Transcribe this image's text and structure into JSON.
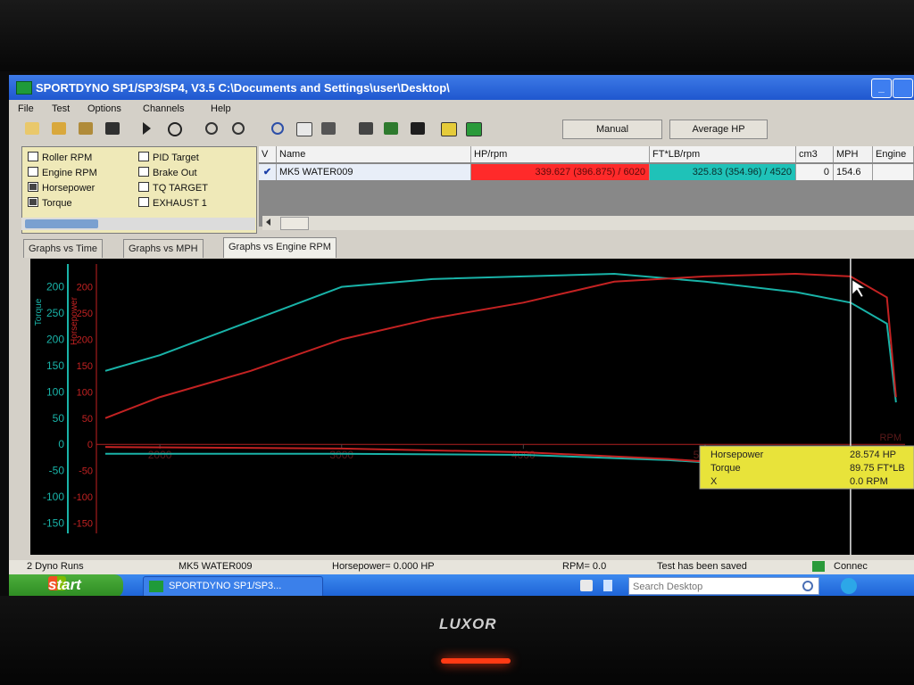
{
  "window": {
    "title": "SPORTDYNO SP1/SP3/SP4, V3.5  C:\\Documents and Settings\\user\\Desktop\\",
    "minimize_glyph": "_"
  },
  "menu": [
    "File",
    "Test",
    "Options",
    "Channels",
    "Help"
  ],
  "toolbar": {
    "manual_label": "Manual",
    "average_hp_label": "Average HP"
  },
  "channels": [
    {
      "label": "Roller RPM",
      "checked": false
    },
    {
      "label": "Engine RPM",
      "checked": false
    },
    {
      "label": "Horsepower",
      "checked": true
    },
    {
      "label": "Torque",
      "checked": true
    },
    {
      "label": "PID Target",
      "checked": false
    },
    {
      "label": "Brake Out",
      "checked": false
    },
    {
      "label": "TQ TARGET",
      "checked": false
    },
    {
      "label": "EXHAUST 1",
      "checked": false
    }
  ],
  "runs_table": {
    "headers": [
      "V",
      "Name",
      "HP/rpm",
      "FT*LB/rpm",
      "cm3",
      "MPH",
      "Engine"
    ],
    "row": {
      "name": "MK5 WATER009",
      "hp_rpm": "339.627 (396.875) / 6020",
      "ftlb_rpm": "325.83 (354.96) / 4520",
      "cm3": "0",
      "mph": "154.6"
    }
  },
  "tabs": [
    "Graphs vs Time",
    "Graphs vs MPH",
    "Graphs vs Engine RPM"
  ],
  "active_tab": 2,
  "chart_data": {
    "type": "line",
    "xlabel": "RPM",
    "ylabel_left": "Torque",
    "ylabel_right": "Horsepower",
    "x_ticks": [
      "2000",
      "3000",
      "4000",
      "5000"
    ],
    "y_ticks_left": [
      "200",
      "250",
      "200",
      "150",
      "100",
      "50",
      "0",
      "-50",
      "-100",
      "-150"
    ],
    "y_ticks_right": [
      "200",
      "250",
      "200",
      "150",
      "100",
      "50",
      "0",
      "-50",
      "-100",
      "-150"
    ],
    "xlim": [
      1700,
      6100
    ],
    "ylim": [
      -190,
      330
    ],
    "series": [
      {
        "name": "Torque",
        "color": "#19b3a8",
        "x": [
          1700,
          2000,
          2500,
          3000,
          3500,
          4000,
          4500,
          5000,
          5500,
          5800,
          6000,
          6050
        ],
        "values": [
          140,
          170,
          235,
          300,
          315,
          320,
          325,
          310,
          290,
          270,
          230,
          80
        ]
      },
      {
        "name": "Horsepower",
        "color": "#c32222",
        "x": [
          1700,
          2000,
          2500,
          3000,
          3500,
          4000,
          4500,
          5000,
          5500,
          5800,
          6000,
          6050
        ],
        "values": [
          50,
          90,
          140,
          200,
          240,
          270,
          310,
          320,
          325,
          320,
          280,
          90
        ]
      },
      {
        "name": "Torque trace",
        "color": "#19b3a8",
        "x": [
          1700,
          3000,
          4000,
          4800,
          5500
        ],
        "values": [
          -18,
          -18,
          -20,
          -30,
          -45
        ]
      },
      {
        "name": "Horsepower trace",
        "color": "#c32222",
        "x": [
          1700,
          3000,
          4000,
          4800,
          5500
        ],
        "values": [
          -5,
          -8,
          -15,
          -28,
          -45
        ]
      }
    ],
    "cursor_x": 5800
  },
  "cursor_readout": [
    {
      "label": "Horsepower",
      "value": "28.574 HP"
    },
    {
      "label": "Torque",
      "value": "89.75 FT*LB"
    },
    {
      "label": "X",
      "value": "0.0 RPM"
    }
  ],
  "status": {
    "runs": "2 Dyno Runs",
    "run_name": "MK5 WATER009",
    "hp": "Horsepower= 0.000 HP",
    "rpm": "RPM= 0.0",
    "message": "Test has been saved",
    "connection": "Connec"
  },
  "taskbar": {
    "start_label": "start",
    "task_label": "SPORTDYNO SP1/SP3...",
    "search_placeholder": "Search Desktop"
  },
  "monitor": {
    "brand": "LUXOR"
  },
  "colors": {
    "hp_cell": "#ff2a2a",
    "ftlb_cell": "#1fc2b8",
    "readout_bg": "#e8e33a",
    "torque": "#19b3a8",
    "horsepower": "#c32222"
  }
}
